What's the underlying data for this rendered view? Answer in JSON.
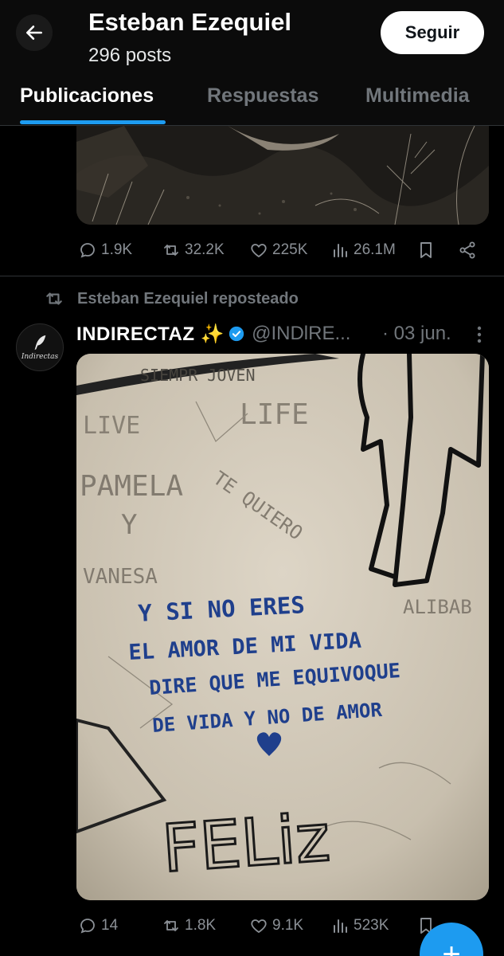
{
  "header": {
    "name": "Esteban Ezequiel",
    "posts_count": "296 posts",
    "follow_label": "Seguir"
  },
  "tabs": [
    {
      "label": "Publicaciones",
      "active": true
    },
    {
      "label": "Respuestas",
      "active": false
    },
    {
      "label": "Multimedia",
      "active": false
    }
  ],
  "post1": {
    "replies": "1.9K",
    "reposts": "32.2K",
    "likes": "225K",
    "views": "26.1M"
  },
  "post2": {
    "repost_context": "Esteban Ezequiel reposteado",
    "avatar_text": "Indirectas",
    "author": "INDIRECTAZ ✨",
    "handle": "@INDlRE...",
    "date": "· 03 jun.",
    "image_text": {
      "line1": "Y SI NO ERES",
      "line2": "EL AMOR DE MI VIDA",
      "line3": "DIRE QUE ME EQUIVOQUE",
      "line4": "DE VIDA   Y NO DE AMOR",
      "wall_top": "SIEMPR JOVEN",
      "wall_live": "LIVE",
      "wall_life": "LIFE",
      "wall_pamela": "PAMELA",
      "wall_y": "Y",
      "wall_vanesa": "VANESA",
      "wall_tequiero": "TE QUIERO",
      "wall_alibab": "ALIBAB",
      "wall_feliz": "FELiz"
    },
    "replies": "14",
    "reposts": "1.8K",
    "likes": "9.1K",
    "views": "523K"
  },
  "colors": {
    "accent": "#1d9bf0",
    "background": "#000000",
    "muted": "#71767b",
    "marker_ink": "#1f3f8c"
  }
}
